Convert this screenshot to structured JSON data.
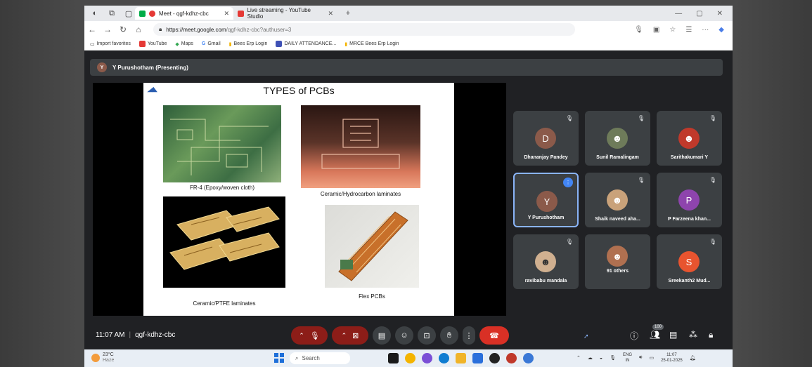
{
  "browser": {
    "tabs": [
      {
        "title": "Meet - qgf-kdhz-cbc",
        "active": true
      },
      {
        "title": "Live streaming - YouTube Studio",
        "active": false
      }
    ],
    "new_tab": "+",
    "url_host": "https://meet.google.com",
    "url_path": "/qgf-kdhz-cbc?authuser=3",
    "bookmarks": [
      "Import favorites",
      "YouTube",
      "Maps",
      "Gmail",
      "Bees Erp Login",
      "DAILY ATTENDANCE...",
      "MRCE Bees Erp Login"
    ]
  },
  "meet": {
    "presenter_initial": "Y",
    "presenter_label": "Y Purushotham (Presenting)",
    "slide": {
      "title": "TYPES of PCBs",
      "captions": [
        "FR-4 (Epoxy/woven cloth)",
        "Ceramic/Hydrocarbon laminates",
        "Ceramic/PTFE laminates",
        "Flex PCBs"
      ]
    },
    "participants": [
      {
        "name": "Dhananjay Pandey",
        "initial": "D",
        "color": "#8b5a4a",
        "muted": true
      },
      {
        "name": "Sunil Ramalingam",
        "initial": "",
        "color": "#6e7b5a",
        "muted": true
      },
      {
        "name": "Sarithakumari Y",
        "initial": "",
        "color": "#c0392b",
        "muted": true
      },
      {
        "name": "Y Purushotham",
        "initial": "Y",
        "color": "#8b5a4a",
        "muted": false,
        "speaking": true
      },
      {
        "name": "Shaik naveed aha...",
        "initial": "",
        "color": "#c9a27a",
        "muted": true
      },
      {
        "name": "P Farzeena khan...",
        "initial": "P",
        "color": "#8e44ad",
        "muted": true
      },
      {
        "name": "ravibabu mandala",
        "initial": "",
        "color": "#d0b090",
        "muted": true
      },
      {
        "name": "91 others",
        "initial": "",
        "color": "#b07050",
        "muted": false
      },
      {
        "name": "Sreekanth2 Mud...",
        "initial": "S",
        "color": "#e8542f",
        "muted": true
      }
    ],
    "time": "11:07 AM",
    "meeting_code": "qgf-kdhz-cbc",
    "people_count": "100"
  },
  "taskbar": {
    "temperature": "23°C",
    "weather": "Haze",
    "search_placeholder": "Search",
    "lang": "ENG",
    "region": "IN",
    "time": "11:07",
    "date": "25-01-2025"
  }
}
